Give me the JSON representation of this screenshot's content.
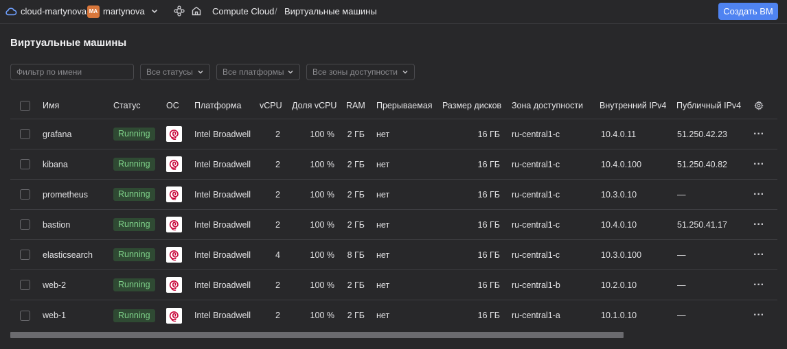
{
  "header": {
    "cloud_name": "cloud-martynova",
    "folder_initials": "MA",
    "folder_name": "martynova",
    "breadcrumb_service": "Compute Cloud",
    "breadcrumb_separator": "/",
    "breadcrumb_page": "Виртуальные машины",
    "create_button": "Создать ВМ"
  },
  "page": {
    "title": "Виртуальные машины"
  },
  "filters": {
    "name_placeholder": "Фильтр по имени",
    "status_select": "Все статусы",
    "platform_select": "Все платформы",
    "zone_select": "Все зоны доступности"
  },
  "table": {
    "columns": {
      "name": "Имя",
      "status": "Статус",
      "os": "ОС",
      "platform": "Платформа",
      "vcpu": "vCPU",
      "vcpu_share": "Доля vCPU",
      "ram": "RAM",
      "preemptible": "Прерываемая",
      "disk": "Размер дисков",
      "zone": "Зона доступности",
      "internal_ipv4": "Внутренний IPv4",
      "public_ipv4": "Публичный IPv4"
    },
    "rows": [
      {
        "name": "grafana",
        "status": "Running",
        "platform": "Intel Broadwell",
        "vcpu": "2",
        "share": "100 %",
        "ram": "2 ГБ",
        "preemptible": "нет",
        "disk": "16 ГБ",
        "zone": "ru-central1-c",
        "ipv4": "10.4.0.11",
        "public": "51.250.42.23"
      },
      {
        "name": "kibana",
        "status": "Running",
        "platform": "Intel Broadwell",
        "vcpu": "2",
        "share": "100 %",
        "ram": "2 ГБ",
        "preemptible": "нет",
        "disk": "16 ГБ",
        "zone": "ru-central1-c",
        "ipv4": "10.4.0.100",
        "public": "51.250.40.82"
      },
      {
        "name": "prometheus",
        "status": "Running",
        "platform": "Intel Broadwell",
        "vcpu": "2",
        "share": "100 %",
        "ram": "2 ГБ",
        "preemptible": "нет",
        "disk": "16 ГБ",
        "zone": "ru-central1-c",
        "ipv4": "10.3.0.10",
        "public": "—"
      },
      {
        "name": "bastion",
        "status": "Running",
        "platform": "Intel Broadwell",
        "vcpu": "2",
        "share": "100 %",
        "ram": "2 ГБ",
        "preemptible": "нет",
        "disk": "16 ГБ",
        "zone": "ru-central1-c",
        "ipv4": "10.4.0.10",
        "public": "51.250.41.17"
      },
      {
        "name": "elasticsearch",
        "status": "Running",
        "platform": "Intel Broadwell",
        "vcpu": "4",
        "share": "100 %",
        "ram": "8 ГБ",
        "preemptible": "нет",
        "disk": "16 ГБ",
        "zone": "ru-central1-c",
        "ipv4": "10.3.0.100",
        "public": "—"
      },
      {
        "name": "web-2",
        "status": "Running",
        "platform": "Intel Broadwell",
        "vcpu": "2",
        "share": "100 %",
        "ram": "2 ГБ",
        "preemptible": "нет",
        "disk": "16 ГБ",
        "zone": "ru-central1-b",
        "ipv4": "10.2.0.10",
        "public": "—"
      },
      {
        "name": "web-1",
        "status": "Running",
        "platform": "Intel Broadwell",
        "vcpu": "2",
        "share": "100 %",
        "ram": "2 ГБ",
        "preemptible": "нет",
        "disk": "16 ГБ",
        "zone": "ru-central1-a",
        "ipv4": "10.1.0.10",
        "public": "—"
      }
    ]
  },
  "icons": {
    "cloud": "cloud-icon",
    "chevron": "chevron-down-icon",
    "nodes": "nodes-icon",
    "home": "home-icon",
    "os": "debian-logo-icon",
    "settings": "gear-icon",
    "row_menu": "more-dots-icon"
  },
  "colors": {
    "accent": "#4f83f1",
    "running_bg": "#2f4a33",
    "running_text": "#7fd38a",
    "folder_badge": "#d9773b",
    "background": "#28282a"
  }
}
